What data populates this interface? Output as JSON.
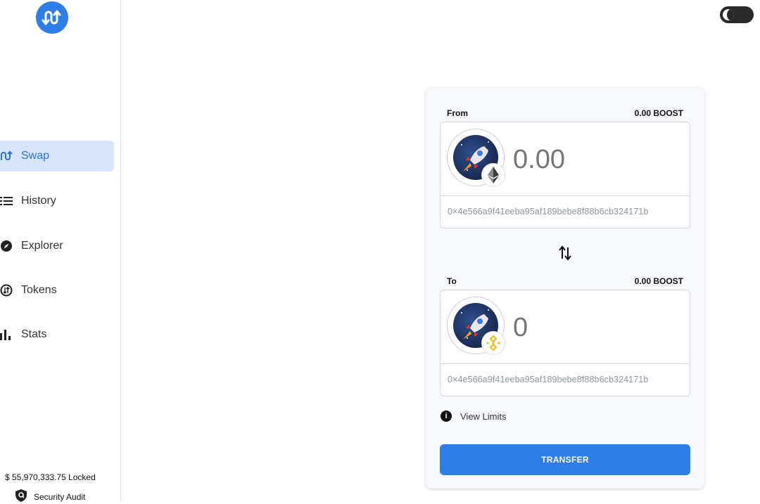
{
  "app": {
    "logo_icon": "bridge-logo-icon",
    "brand_color": "#2f7ee8"
  },
  "sidebar": {
    "items": [
      {
        "label": "Swap",
        "icon": "swap-icon",
        "active": true
      },
      {
        "label": "History",
        "icon": "list-icon",
        "active": false
      },
      {
        "label": "Explorer",
        "icon": "compass-icon",
        "active": false
      },
      {
        "label": "Tokens",
        "icon": "token-exchange-icon",
        "active": false
      },
      {
        "label": "Stats",
        "icon": "bar-chart-icon",
        "active": false
      }
    ],
    "locked_text": "$ 55,970,333.75 Locked",
    "audit_label": "Security Audit"
  },
  "theme_toggle": {
    "icon": "moon-icon",
    "mode": "dark"
  },
  "swap": {
    "from": {
      "label": "From",
      "balance": "0.00 BOOST",
      "amount_placeholder": "0.00",
      "address": "0×4e566a9f41eeba95af189bebe8f88b6cb324171b",
      "chain_icon": "ethereum-icon"
    },
    "to": {
      "label": "To",
      "balance": "0.00 BOOST",
      "amount_placeholder": "0",
      "address": "0×4e566a9f41eeba95af189bebe8f88b6cb324171b",
      "chain_icon": "bnb-icon"
    },
    "view_limits_label": "View Limits",
    "transfer_label": "TRANSFER"
  }
}
